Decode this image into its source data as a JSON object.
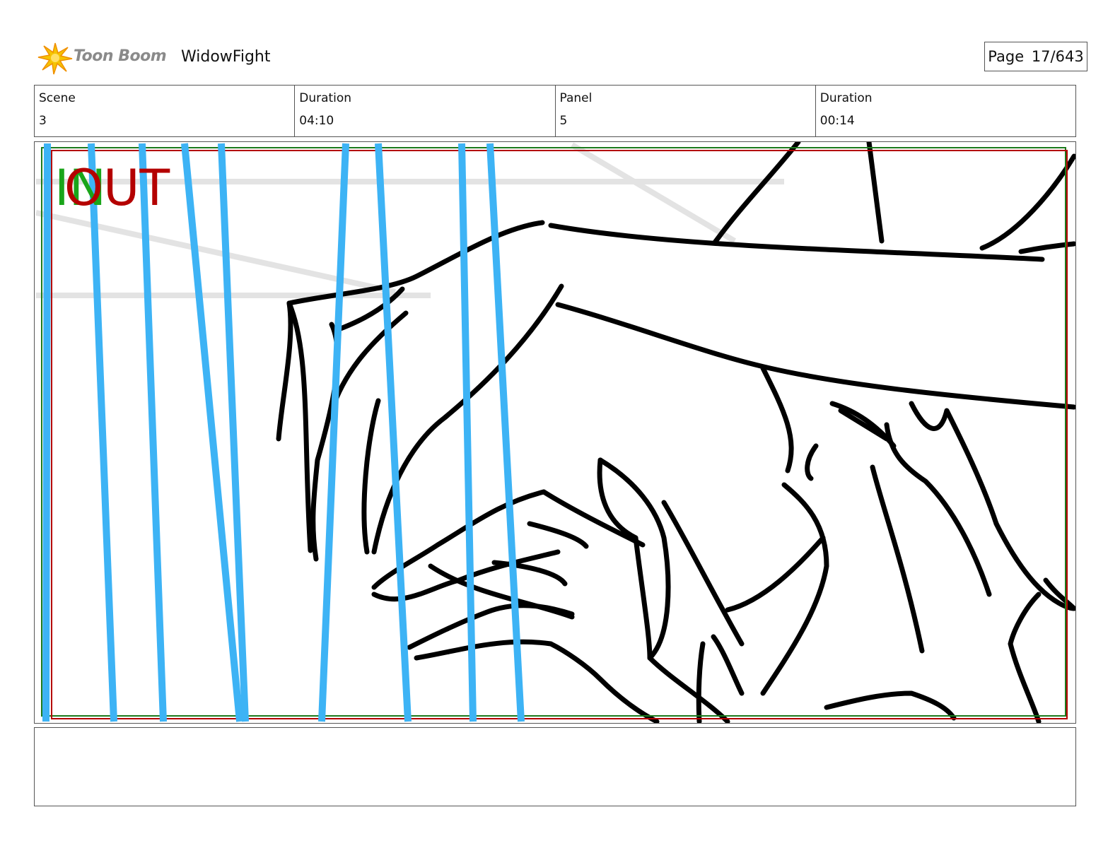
{
  "header": {
    "logo_text": "Toon Boom",
    "project_title": "WidowFight",
    "page_label": "Page",
    "page_value": "17/643"
  },
  "info": {
    "scene_label": "Scene",
    "scene_value": "3",
    "scene_duration_label": "Duration",
    "scene_duration_value": "04:10",
    "panel_label": "Panel",
    "panel_value": "5",
    "panel_duration_label": "Duration",
    "panel_duration_value": "00:14"
  },
  "panel": {
    "in_marker": "IN",
    "out_marker": "OUT",
    "colors": {
      "in": "#1aa51a",
      "out": "#b40000",
      "camera_lines": "#3db3f5",
      "ink": "#000000",
      "guides": "#e3e3e3"
    }
  },
  "caption": {
    "text": ""
  },
  "icons": [
    "toon-boom-logo-icon"
  ]
}
